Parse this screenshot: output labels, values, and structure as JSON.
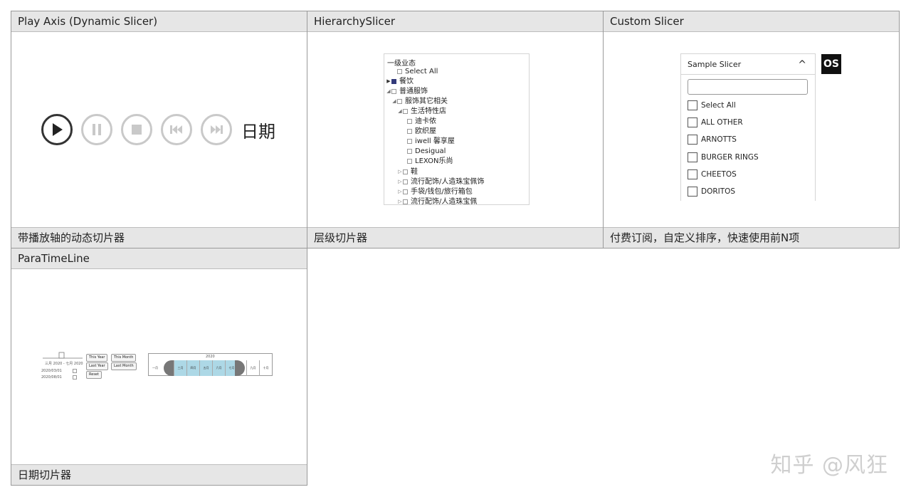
{
  "cells": {
    "play_axis": {
      "title": "Play Axis (Dynamic Slicer)",
      "caption": "带播放轴的动态切片器",
      "label": "日期"
    },
    "hierarchy": {
      "title": "HierarchySlicer",
      "caption": "层级切片器",
      "tree_title": "一级业态",
      "rows": [
        "Select All",
        "餐饮",
        "普通服饰",
        "服饰其它相关",
        "生活特性店",
        "迪卡侬",
        "欧织屋",
        "iwell 馨享屋",
        "Desigual",
        "LEXON乐尚",
        "鞋",
        "流行配饰/人造珠宝佩饰",
        "手袋/钱包/旅行箱包",
        "流行配饰/人造珠宝佩"
      ]
    },
    "custom": {
      "title": "Custom Slicer",
      "caption": "付费订阅，自定义排序，快速使用前N项",
      "header": "Sample Slicer",
      "items": [
        "Select All",
        "ALL OTHER",
        "ARNOTTS",
        "BURGER RINGS",
        "CHEETOS",
        "DORITOS"
      ],
      "logo": "OS"
    },
    "paratimeline": {
      "title": "ParaTimeLine",
      "caption": "日期切片器",
      "range_text": "三月 2020 - 七月 2020",
      "start_date": "2020/03/01",
      "end_date": "2020/08/01",
      "buttons": [
        "This Year",
        "This Month",
        "Last Year",
        "Last Month",
        "Reset"
      ],
      "year": "2020",
      "months": [
        "一月",
        "三月",
        "四月",
        "五月",
        "六月",
        "七月",
        "九月",
        "十月"
      ]
    }
  },
  "watermark": "知乎 @风狂"
}
